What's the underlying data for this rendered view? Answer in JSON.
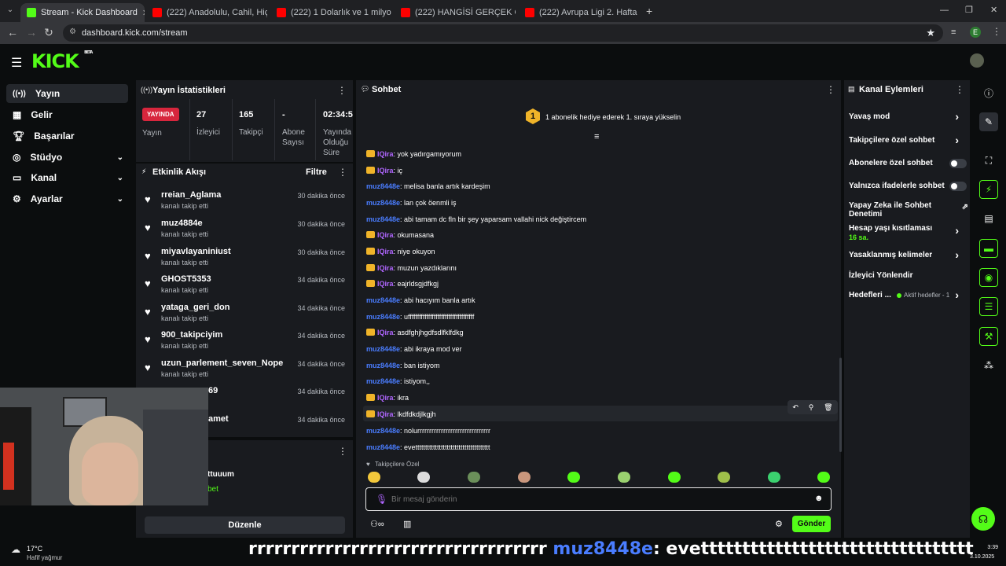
{
  "browser": {
    "tabs": [
      {
        "title": "Stream - Kick Dashboard",
        "active": true
      },
      {
        "title": "(222) Anadolulu, Cahil, Hiçbir Ö"
      },
      {
        "title": "(222) 1 Dolarlık ve 1 milyon do"
      },
      {
        "title": "(222) HANGİSİ GERÇEK GURBE"
      },
      {
        "title": "(222) Avrupa Ligi 2. Hafta | Ron"
      }
    ],
    "url": "dashboard.kick.com/stream",
    "profile_initial": "E"
  },
  "app": {
    "logo": "KICK",
    "logo_badge": "BETA"
  },
  "sidebar": {
    "items": [
      {
        "label": "Yayın",
        "icon": "broadcast-icon"
      },
      {
        "label": "Gelir",
        "icon": "revenue-icon"
      },
      {
        "label": "Başarılar",
        "icon": "trophy-icon"
      },
      {
        "label": "Stüdyo",
        "icon": "studio-icon"
      },
      {
        "label": "Kanal",
        "icon": "channel-icon"
      },
      {
        "label": "Ayarlar",
        "icon": "gear-icon"
      }
    ]
  },
  "stats": {
    "title": "Yayın İstatistikleri",
    "live_badge": "YAYINDA",
    "live_label": "Yayın",
    "viewers_value": "27",
    "viewers_label": "İzleyici",
    "followers_value": "165",
    "followers_label": "Takipçi",
    "subs_value": "-",
    "subs_label": "Abone Sayısı",
    "uptime_value": "02:34:58",
    "uptime_label": "Yayında Olduğu Süre"
  },
  "activity": {
    "title": "Etkinlik Akışı",
    "filter": "Filtre",
    "items": [
      {
        "name": "rreian_Aglama",
        "sub": "kanalı takip etti",
        "time": "30 dakika önce"
      },
      {
        "name": "muz4884e",
        "sub": "kanalı takip etti",
        "time": "30 dakika önce"
      },
      {
        "name": "miyavlayaniniust",
        "sub": "kanalı takip etti",
        "time": "30 dakika önce"
      },
      {
        "name": "GHOST5353",
        "sub": "kanalı takip etti",
        "time": "34 dakika önce"
      },
      {
        "name": "yataga_geri_don",
        "sub": "kanalı takip etti",
        "time": "34 dakika önce"
      },
      {
        "name": "900_takipciyim",
        "sub": "kanalı takip etti",
        "time": "34 dakika önce"
      },
      {
        "name": "uzun_parlement_seven_Nope",
        "sub": "kanalı takip etti",
        "time": "34 dakika önce"
      },
      {
        "name": "69",
        "sub": "",
        "time": "34 dakika önce"
      },
      {
        "name": "amet",
        "sub": "",
        "time": "34 dakika önce"
      }
    ]
  },
  "lower_panel": {
    "user": "ttuuum",
    "sub": "bet",
    "edit_button": "Düzenle"
  },
  "chat": {
    "title": "Sohbet",
    "gift_badge": "1",
    "gift_text": "1 abonelik hediye ederek 1. sıraya yükselin",
    "messages": [
      {
        "user": "IQira",
        "crown": true,
        "text": ": yok yadırgamıyorum"
      },
      {
        "user": "IQira",
        "crown": true,
        "text": ": iç"
      },
      {
        "user": "muz8448e",
        "crown": false,
        "text": ": melisa banla artık kardeşim"
      },
      {
        "user": "muz8448e",
        "crown": false,
        "text": ": lan çok öenmli iş"
      },
      {
        "user": "muz8448e",
        "crown": false,
        "text": ": abi tamam dc fln bir şey yaparsam vallahi nick değiştircem"
      },
      {
        "user": "IQira",
        "crown": true,
        "text": ": okumasana"
      },
      {
        "user": "IQira",
        "crown": true,
        "text": ": niye okuyon"
      },
      {
        "user": "IQira",
        "crown": true,
        "text": ": muzun yazdıklarını"
      },
      {
        "user": "IQira",
        "crown": true,
        "text": ": eajrldsgjdfkgj"
      },
      {
        "user": "muz8448e",
        "crown": false,
        "text": ": abi hacıyım banla artık"
      },
      {
        "user": "muz8448e",
        "crown": false,
        "text": ": uffffffffffffffffffffffffffffffffffff"
      },
      {
        "user": "IQira",
        "crown": true,
        "text": ": asdfghjhgdfsdlfklfdkg"
      },
      {
        "user": "muz8448e",
        "crown": false,
        "text": ": abi ikraya mod ver"
      },
      {
        "user": "muz8448e",
        "crown": false,
        "text": ": ban istiyom"
      },
      {
        "user": "muz8448e",
        "crown": false,
        "text": ": istiyom,,"
      },
      {
        "user": "IQira",
        "crown": true,
        "text": ": ikra"
      },
      {
        "user": "IQira",
        "crown": true,
        "text": ": lkdfdkdjlkgjh"
      },
      {
        "user": "muz8448e",
        "crown": false,
        "text": ": nolurrrrrrrrrrrrrrrrrrrrrrrrrrrrrrr"
      },
      {
        "user": "muz8448e",
        "crown": false,
        "text": ": evetttttttttttttttttttttttttttttttttttttt"
      }
    ],
    "emote_section": "Takipçilere Özel",
    "input_placeholder": "Bir mesaj gönderin",
    "send_button": "Gönder"
  },
  "channel_actions": {
    "title": "Kanal Eylemleri",
    "rows": [
      {
        "label": "Yavaş mod",
        "type": "arrow"
      },
      {
        "label": "Takipçilere özel sohbet",
        "type": "arrow"
      },
      {
        "label": "Abonelere özel sohbet",
        "type": "toggle"
      },
      {
        "label": "Yalnızca ifadelerle sohbet",
        "type": "toggle"
      },
      {
        "label": "Yapay Zeka ile Sohbet Denetimi",
        "type": "ext"
      },
      {
        "label": "Hesap yaşı kısıtlaması",
        "type": "arrow",
        "sub": "16 sa."
      },
      {
        "label": "Yasaklanmış kelimeler",
        "type": "arrow"
      },
      {
        "label": "İzleyici Yönlendir",
        "type": "none"
      },
      {
        "label": "Hedefleri ...",
        "type": "arrow",
        "sub": "Aktif hedefler - 1"
      }
    ]
  },
  "overlay": {
    "ticker": "rrrrrrrrrrrrrrrrrrrrrrrrrrrrrrrrrrr",
    "ticker_user": "muz8448e",
    "ticker_msg": ": evettttttttttttttttttttttttttttttttt"
  },
  "taskbar": {
    "weather_temp": "17°C",
    "weather_desc": "Hafif yağmur",
    "time": "3:39",
    "date": "3.10.2025"
  },
  "colors": {
    "kick_green": "#53fc18",
    "user_blue": "#4a7dff",
    "user_purple": "#b066ff",
    "panel": "#191b1f",
    "bg": "#0b0d0e"
  }
}
